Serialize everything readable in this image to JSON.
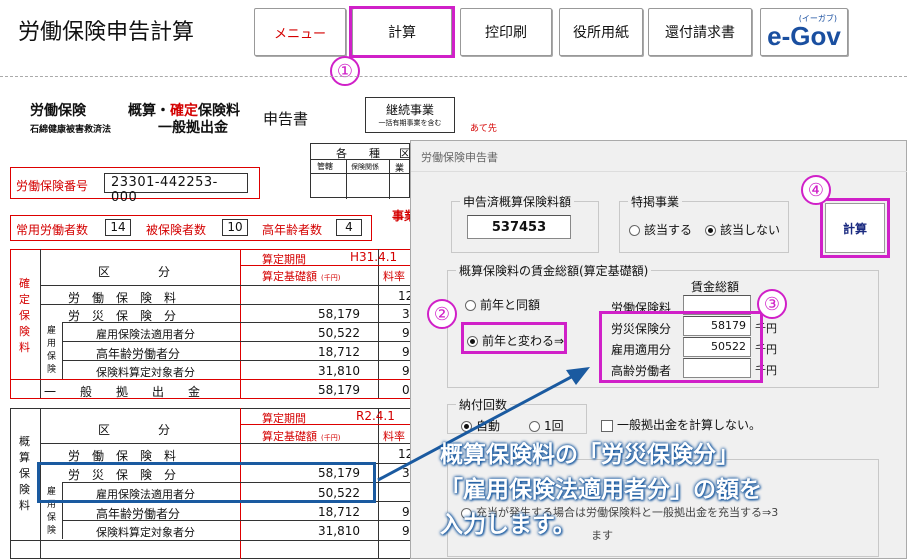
{
  "app": {
    "title": "労働保険申告計算"
  },
  "toolbar": {
    "menu": "メニュー",
    "calc": "計算",
    "print": "控印刷",
    "office": "役所用紙",
    "refund": "還付請求書",
    "egov_logo": "e-Gov",
    "egov_ruby": "(イーガブ)"
  },
  "steps": {
    "s1": "①",
    "s2": "②",
    "s3": "③",
    "s4": "④"
  },
  "form": {
    "title_a": "労働保険",
    "title_b": "概算・",
    "title_b_red": "確定",
    "title_b2": "保険料",
    "title_c": "石綿健康被害救済法",
    "title_d": "一般拠出金",
    "title_e": "申告書",
    "continuing": "継続事業",
    "continuing_sub": "一括有期事業を含む",
    "addressee": "あて先",
    "kind_a": "各",
    "kind_b": "種",
    "kind_c": "区",
    "kind_d": "管轄",
    "kind_e": "保険関係",
    "kind_f": "業",
    "insurance_no_label": "労働保険番号",
    "insurance_no": "23301-442253-000",
    "workers_label": "常用労働者数",
    "workers": "14",
    "insured_label": "被保険者数",
    "insured": "10",
    "elderly_label": "高年齢者数",
    "elderly": "4",
    "office_label": "事業",
    "confirmed_side": [
      "確",
      "定",
      "保",
      "険",
      "料"
    ],
    "estimated_side": [
      "概",
      "算",
      "保",
      "険",
      "料"
    ],
    "col_kubun": "区　　　　分",
    "period_label": "算定期間",
    "period_confirmed": "H31.4.1",
    "period_estimated": "R2.4.1",
    "base_label": "算定基礎額",
    "base_unit": "(千円)",
    "rate_label": "料率",
    "rows_confirmed": [
      {
        "label": "労　働　保　険　料",
        "value": "",
        "rate": "12"
      },
      {
        "label": "労　災　保　険　分",
        "value": "58,179",
        "rate": "3"
      },
      {
        "label": "雇用保険法適用者分",
        "value": "50,522",
        "rate": "9"
      },
      {
        "label": "高年齢労働者分",
        "value": "18,712",
        "rate": "9"
      },
      {
        "label": "保険料算定対象者分",
        "value": "31,810",
        "rate": "9"
      }
    ],
    "employ_side": [
      "雇",
      "用",
      "保",
      "険"
    ],
    "general": {
      "label": "一　　般　　拠　　出　　金",
      "value": "58,179",
      "rate": "0"
    },
    "rows_estimated": [
      {
        "label": "労　働　保　険　料",
        "value": "",
        "rate": "12"
      },
      {
        "label": "労　災　保　険　分",
        "value": "58,179",
        "rate": "3"
      },
      {
        "label": "雇用保険法適用者分",
        "value": "50,522",
        "rate": ""
      },
      {
        "label": "高年齢労働者分",
        "value": "18,712",
        "rate": "9"
      },
      {
        "label": "保険料算定対象者分",
        "value": "31,810",
        "rate": "9"
      }
    ],
    "estimated_employ_side": [
      "雇",
      "用",
      "保",
      "険"
    ]
  },
  "dialog": {
    "title": "労働保険申告書",
    "reported_label": "申告済概算保険料額",
    "reported_value": "537453",
    "special_label": "特掲事業",
    "special_yes": "該当する",
    "special_no": "該当しない",
    "calc_button": "計算",
    "wage_group": "概算保険料の賃金総額(算定基礎額)",
    "wage_total": "賃金総額",
    "same_as_last": "前年と同額",
    "changed": "前年と変わる⇒",
    "row_labor": "労働保険料",
    "row_accident": "労災保険分",
    "row_accident_value": "58179",
    "row_employ": "雇用適用分",
    "row_employ_value": "50522",
    "row_elderly": "高齢労働者",
    "unit": "千円",
    "pay_group": "納付回数",
    "pay_auto": "自動",
    "pay_once": "1回",
    "no_general": "一般拠出金を計算しない。",
    "refund_note": "充当が発生する場合は労働保険料と一般拠出金を充当する⇒3",
    "refund_note2": "ます"
  },
  "callout": {
    "line1": "概算保険料の「労災保険分」",
    "line2": "「雇用保険法適用者分」の額を",
    "line3": "入力します。"
  }
}
